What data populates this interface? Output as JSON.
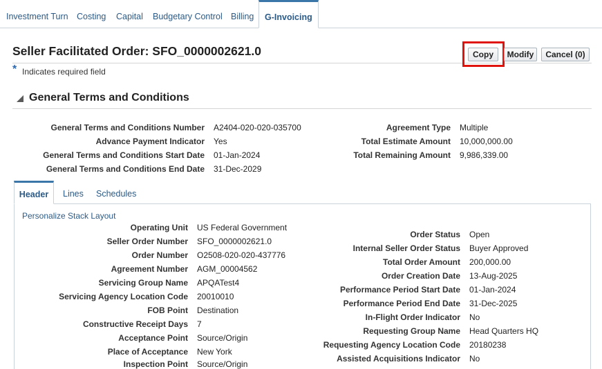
{
  "top_tabs": {
    "t1": "Investment Turn",
    "t2": "Costing",
    "t3": "Capital",
    "t4": "Budgetary Control",
    "t5": "Billing",
    "t6": "G-Invoicing"
  },
  "header": {
    "title": "Seller Facilitated Order: SFO_0000002621.0",
    "required_star": "*",
    "required_text": "Indicates required field",
    "copy_label": "Copy",
    "modify_label": "Modify",
    "cancel_label": "Cancel (0)"
  },
  "section": {
    "title": "General Terms and Conditions",
    "left": [
      {
        "label": "General Terms and Conditions Number",
        "value": "A2404-020-020-035700"
      },
      {
        "label": "Advance Payment Indicator",
        "value": "Yes"
      },
      {
        "label": "General Terms and Conditions Start Date",
        "value": "01-Jan-2024"
      },
      {
        "label": "General Terms and Conditions End Date",
        "value": "31-Dec-2029"
      }
    ],
    "right": [
      {
        "label": "Agreement Type",
        "value": "Multiple"
      },
      {
        "label": "Total Estimate Amount",
        "value": "10,000,000.00"
      },
      {
        "label": "Total Remaining Amount",
        "value": "9,986,339.00"
      }
    ]
  },
  "subtabs": {
    "header": "Header",
    "lines": "Lines",
    "schedules": "Schedules"
  },
  "panel": {
    "personalize": "Personalize Stack Layout",
    "left": [
      {
        "label": "Operating Unit",
        "value": "US Federal Government"
      },
      {
        "label": "Seller Order Number",
        "value": "SFO_0000002621.0"
      },
      {
        "label": "Order Number",
        "value": "O2508-020-020-437776"
      },
      {
        "label": "Agreement Number",
        "value": "AGM_00004562"
      },
      {
        "label": "Servicing Group Name",
        "value": "APQATest4"
      },
      {
        "label": "Servicing Agency Location Code",
        "value": "20010010"
      },
      {
        "label": "FOB Point",
        "value": "Destination"
      },
      {
        "label": "Constructive Receipt Days",
        "value": "7"
      },
      {
        "label": "Acceptance Point",
        "value": "Source/Origin"
      },
      {
        "label": "Place of Acceptance",
        "value": "New York"
      },
      {
        "label": "Inspection Point",
        "value": "Source/Origin"
      }
    ],
    "right": [
      {
        "label": "Order Status",
        "value": "Open"
      },
      {
        "label": "Internal Seller Order Status",
        "value": "Buyer Approved"
      },
      {
        "label": "Total Order Amount",
        "value": "200,000.00"
      },
      {
        "label": "Order Creation Date",
        "value": "13-Aug-2025"
      },
      {
        "label": "Performance Period Start Date",
        "value": "01-Jan-2024"
      },
      {
        "label": "Performance Period End Date",
        "value": "31-Dec-2025"
      },
      {
        "label": "In-Flight Order Indicator",
        "value": "No"
      },
      {
        "label": "Requesting Group Name",
        "value": "Head Quarters HQ"
      },
      {
        "label": "Requesting Agency Location Code",
        "value": "20180238"
      },
      {
        "label": "Assisted Acquisitions Indicator",
        "value": "No"
      }
    ]
  }
}
